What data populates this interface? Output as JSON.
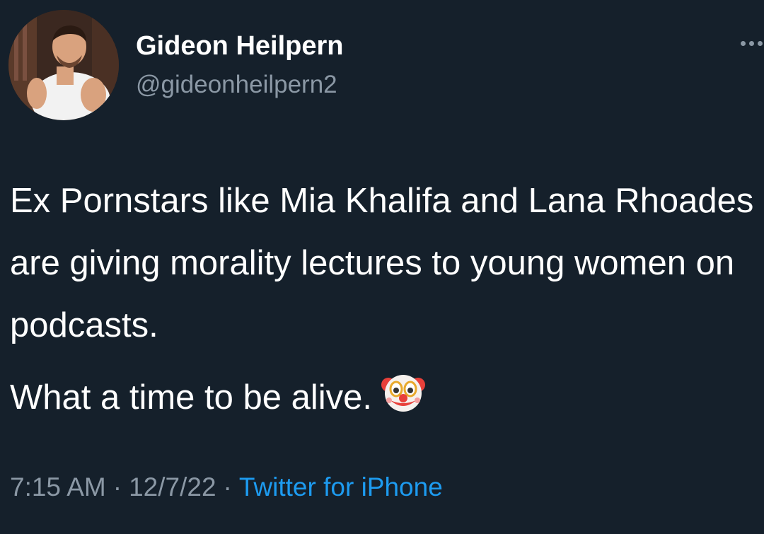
{
  "author": {
    "display_name": "Gideon Heilpern",
    "handle": "@gideonheilpern2",
    "avatar_icon": "profile-photo"
  },
  "tweet": {
    "line_1": "Ex Pornstars like Mia Khalifa and Lana Rhoades are giving morality lectures to young women on podcasts.",
    "line_2": "What a time to be alive.",
    "emoji_icon": "clown-face-icon"
  },
  "meta": {
    "time": "7:15 AM",
    "separator": "·",
    "date": "12/7/22",
    "source": "Twitter for iPhone"
  },
  "colors": {
    "background": "#15202b",
    "secondary_text": "#8b98a5",
    "link": "#1d9bf0"
  }
}
